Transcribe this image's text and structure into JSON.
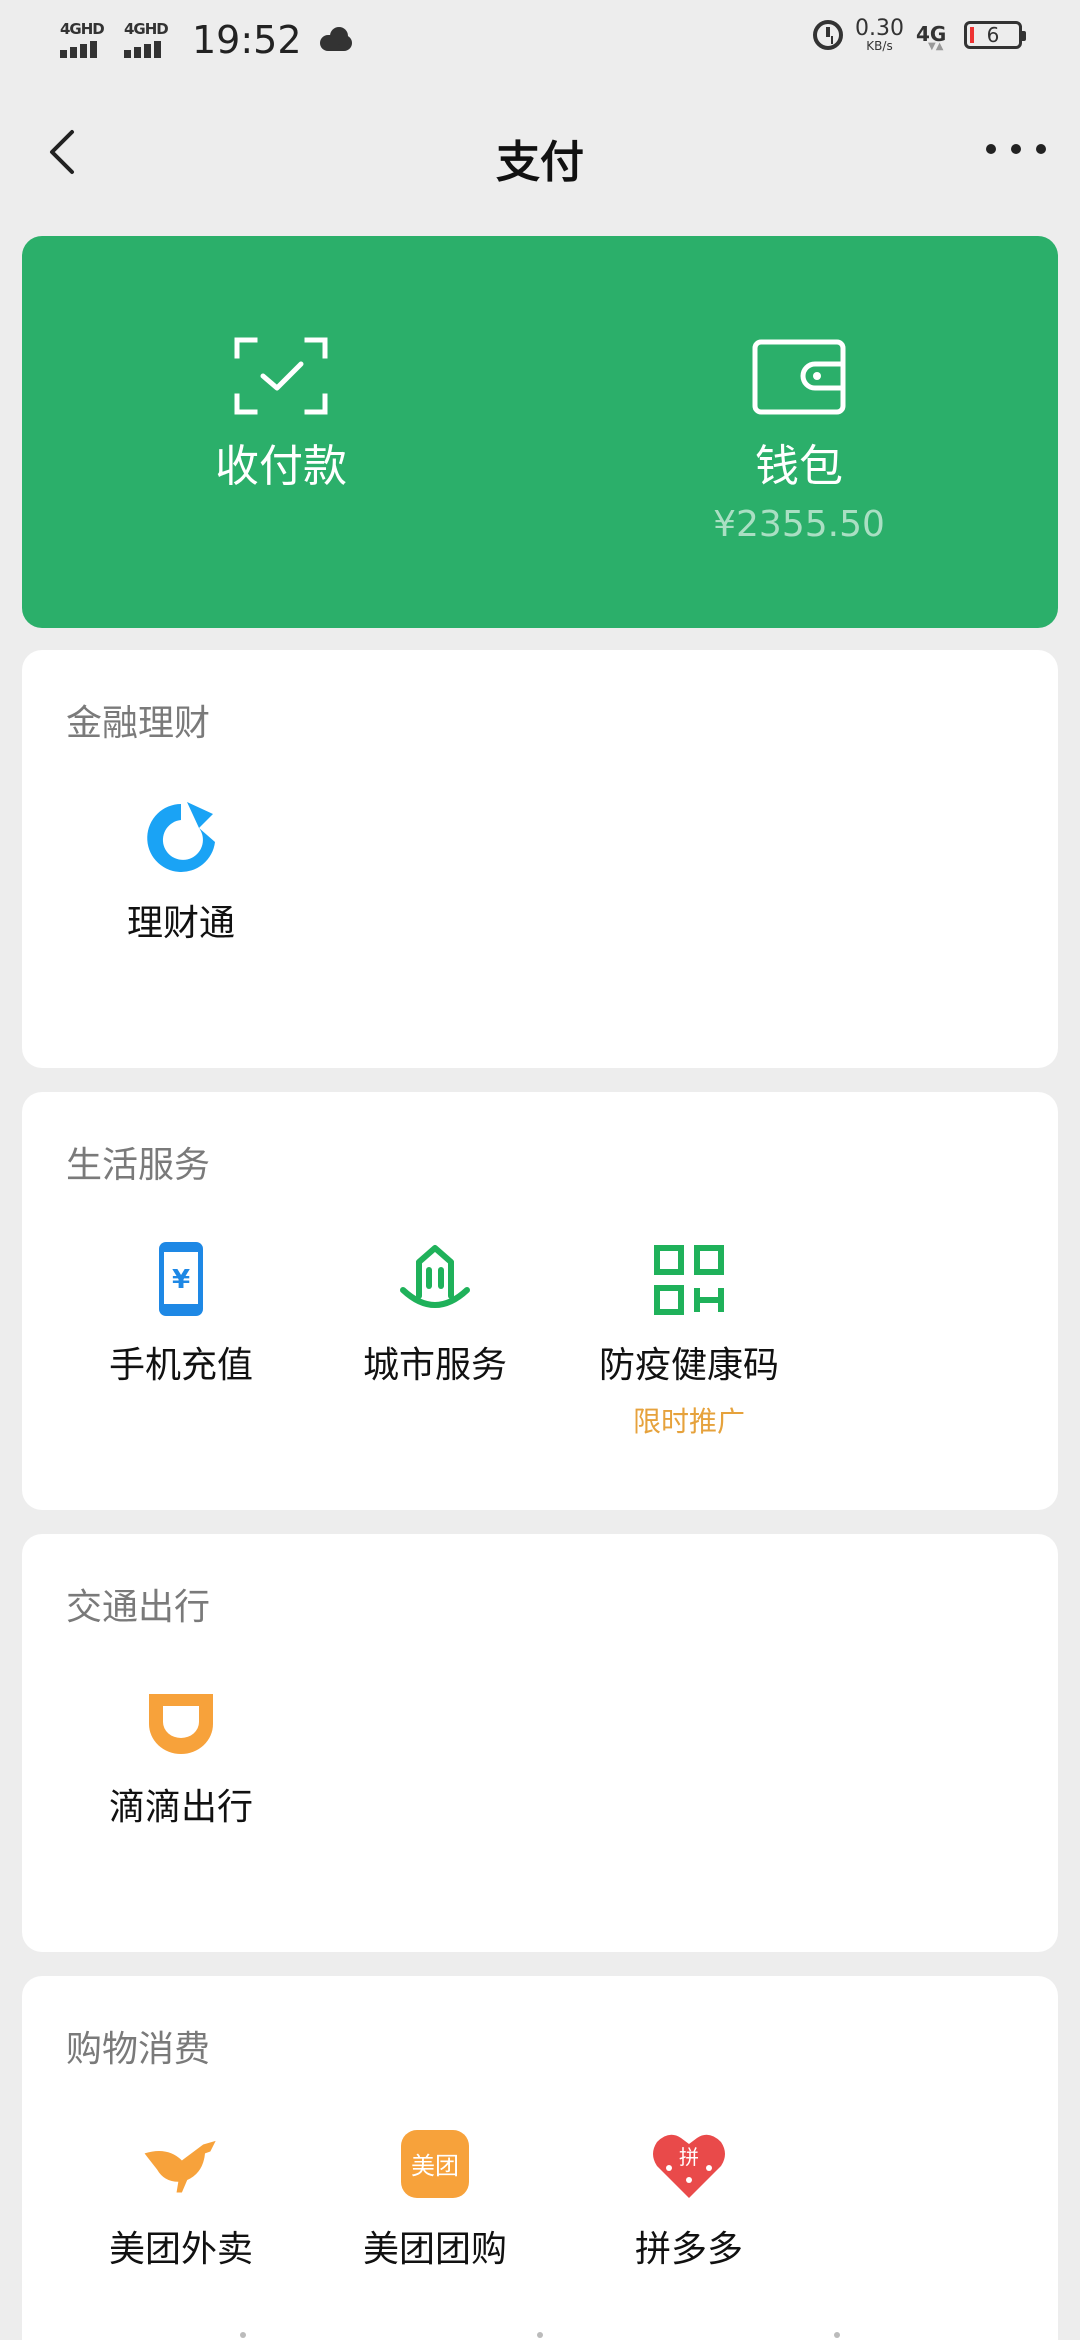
{
  "status_bar": {
    "sim1": "4GHD",
    "sim2": "4GHD",
    "time": "19:52",
    "net_speed_value": "0.30",
    "net_speed_unit": "KB/s",
    "network": "4G",
    "battery": "6"
  },
  "nav": {
    "title": "支付"
  },
  "pay_card": {
    "color": "#2baf6a",
    "receive_label": "收付款",
    "wallet_label": "钱包",
    "wallet_balance": "¥2355.50"
  },
  "sections": {
    "finance": {
      "title": "金融理财",
      "items": [
        {
          "label": "理财通",
          "icon": "licaitong-icon"
        }
      ]
    },
    "life": {
      "title": "生活服务",
      "items": [
        {
          "label": "手机充值",
          "icon": "phone-recharge-icon"
        },
        {
          "label": "城市服务",
          "icon": "city-service-icon"
        },
        {
          "label": "防疫健康码",
          "icon": "health-code-icon",
          "badge": "限时推广"
        }
      ]
    },
    "traffic": {
      "title": "交通出行",
      "items": [
        {
          "label": "滴滴出行",
          "icon": "didi-icon"
        }
      ]
    },
    "shopping": {
      "title": "购物消费",
      "items": [
        {
          "label": "美团外卖",
          "icon": "meituan-waimai-icon"
        },
        {
          "label": "美团团购",
          "icon": "meituan-tuangou-icon",
          "logo_text": "美团"
        },
        {
          "label": "拼多多",
          "icon": "pinduoduo-icon",
          "logo_text": "拼"
        }
      ]
    }
  }
}
